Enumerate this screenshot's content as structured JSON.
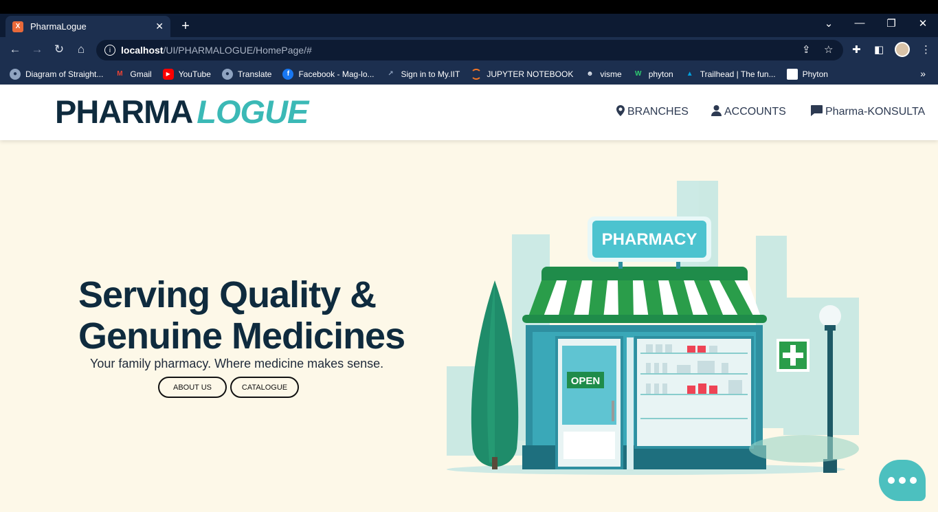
{
  "browser": {
    "tab_title": "PharmaLogue",
    "tab_close": "✕",
    "new_tab": "+",
    "url_host": "localhost",
    "url_path": "/UI/PHARMALOGUE/HomePage/#",
    "bookmarks": [
      {
        "label": "Diagram of Straight...",
        "icon": "globe-icon",
        "color": "#8fa3c0"
      },
      {
        "label": "Gmail",
        "icon": "gmail-icon",
        "color": "#ea4335"
      },
      {
        "label": "YouTube",
        "icon": "youtube-icon",
        "color": "#ff0000"
      },
      {
        "label": "Translate",
        "icon": "globe-icon",
        "color": "#8fa3c0"
      },
      {
        "label": "Facebook - Mag-lo...",
        "icon": "facebook-icon",
        "color": "#1877f2"
      },
      {
        "label": "Sign in to My.IIT",
        "icon": "arrow-icon",
        "color": "#8fa3c0"
      },
      {
        "label": "JUPYTER NOTEBOOK",
        "icon": "jupyter-icon",
        "color": "#f37626"
      },
      {
        "label": "visme",
        "icon": "visme-icon",
        "color": "#dde3ec"
      },
      {
        "label": "phyton",
        "icon": "wix-icon",
        "color": "#2ecc71"
      },
      {
        "label": "Trailhead | The fun...",
        "icon": "trailhead-icon",
        "color": "#00a1e0"
      },
      {
        "label": "Phyton",
        "icon": "page-icon",
        "color": "#ffffff"
      }
    ]
  },
  "site": {
    "logo_part1": "PHARMA",
    "logo_part2": "LOGUE",
    "nav": {
      "branches": "BRANCHES",
      "accounts": "ACCOUNTS",
      "konsulta": "Pharma-KONSULTA"
    },
    "hero": {
      "line1": "Serving Quality &",
      "line2": "Genuine Medicines",
      "subtitle": "Your family pharmacy. Where medicine makes sense.",
      "about_btn": "ABOUT US",
      "catalogue_btn": "CATALOGUE"
    },
    "illustration": {
      "sign": "PHARMACY",
      "door_sign": "OPEN"
    },
    "colors": {
      "navy": "#0f2b3e",
      "teal": "#3bb9b6",
      "cream": "#fdf8e8",
      "green": "#2a9d4a"
    }
  }
}
